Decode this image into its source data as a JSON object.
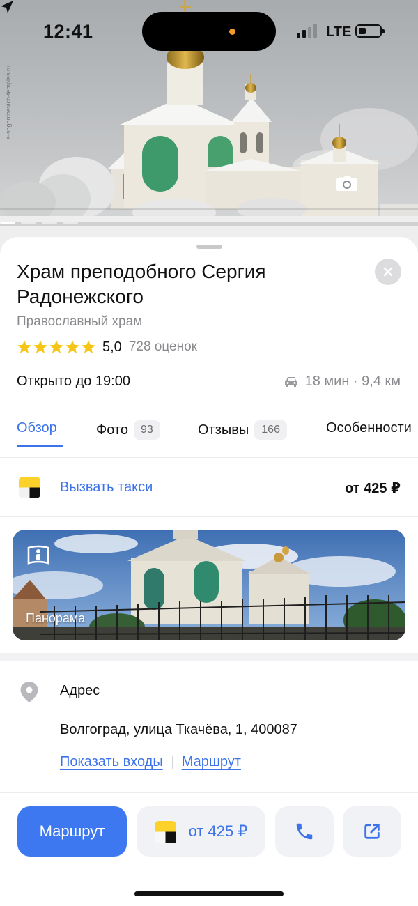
{
  "status_bar": {
    "time": "12:41",
    "network": "LTE",
    "location_icon": "location-arrow-icon",
    "battery_icon": "battery-low-icon"
  },
  "hero": {
    "photo_count": "93",
    "watermark": "e-sogorchevich-temples.ru",
    "camera_icon": "camera-icon"
  },
  "place": {
    "title": "Храм преподобного Сергия Радонежского",
    "category": "Православный храм",
    "rating_value": "5,0",
    "rating_stars": 5,
    "rating_count": "728 оценок",
    "hours": "Открыто до 19:00",
    "drive_time": "18 мин · 9,4 км"
  },
  "tabs": [
    {
      "label": "Обзор",
      "badge": ""
    },
    {
      "label": "Фото",
      "badge": "93"
    },
    {
      "label": "Отзывы",
      "badge": "166"
    },
    {
      "label": "Особенности",
      "badge": ""
    }
  ],
  "taxi": {
    "label": "Вызвать такси",
    "price": "от 425 ₽"
  },
  "panorama": {
    "label": "Панорама"
  },
  "address": {
    "heading": "Адрес",
    "text": "Волгоград, улица Ткачёва, 1, 400087",
    "link_entrances": "Показать входы",
    "link_route": "Маршрут"
  },
  "actions": {
    "route_label": "Маршрут",
    "taxi_price": "от 425 ₽"
  },
  "colors": {
    "accent": "#3c73ea",
    "route_button": "#3d78f0",
    "star": "#f5c518",
    "taxi_yellow": "#fcd12a"
  }
}
